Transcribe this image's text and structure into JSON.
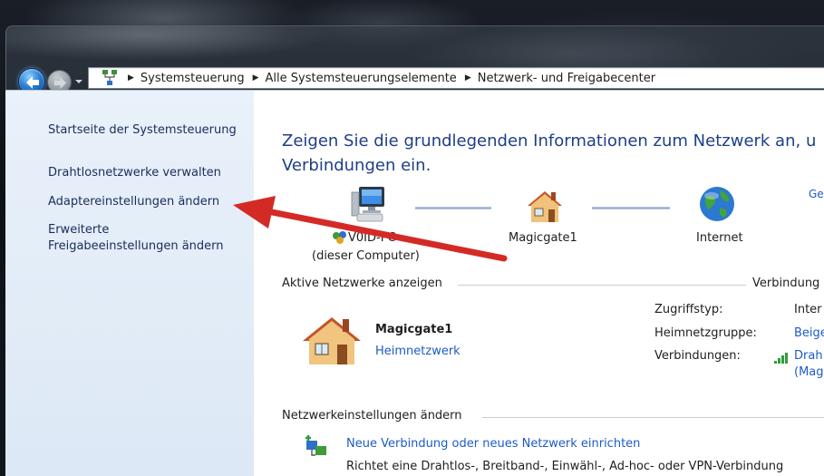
{
  "breadcrumb": {
    "items": [
      "Systemsteuerung",
      "Alle Systemsteuerungselemente",
      "Netzwerk- und Freigabecenter"
    ]
  },
  "sidebar": {
    "items": [
      {
        "label": "Startseite der Systemsteuerung"
      },
      {
        "label": "Drahtlosnetzwerke verwalten"
      },
      {
        "label": "Adaptereinstellungen ändern"
      },
      {
        "label": "Erweiterte"
      },
      {
        "label": "Freigabeeinstellungen ändern"
      }
    ]
  },
  "main": {
    "heading_line1": "Zeigen Sie die grundlegenden Informationen zum Netzwerk an, u",
    "heading_line2": "Verbindungen ein.",
    "full_map_link": "Ge",
    "map": {
      "computer_name": "V0ID-PC",
      "computer_sub": "(dieser Computer)",
      "gateway": "Magicgate1",
      "internet": "Internet"
    },
    "active_section": {
      "title": "Aktive Netzwerke anzeigen",
      "right_link": "Verbindung",
      "network_name": "Magicgate1",
      "network_type": "Heimnetzwerk",
      "rows": [
        {
          "key": "Zugriffstyp:",
          "value": "Inter"
        },
        {
          "key": "Heimnetzgruppe:",
          "value": "Beige"
        },
        {
          "key": "Verbindungen:",
          "value": "Drah"
        }
      ],
      "connection_sub": "(Mag"
    },
    "settings_section": {
      "title": "Netzwerkeinstellungen ändern",
      "new_connection": "Neue Verbindung oder neues Netzwerk einrichten",
      "new_connection_desc": "Richtet eine Drahtlos-, Breitband-, Einwähl-, Ad-hoc- oder VPN-Verbindung"
    }
  },
  "colors": {
    "heading": "#1e3f86",
    "link": "#1e5ac8",
    "annotation_arrow": "#d42a26",
    "sidebar_bg": "#dce8f5"
  }
}
